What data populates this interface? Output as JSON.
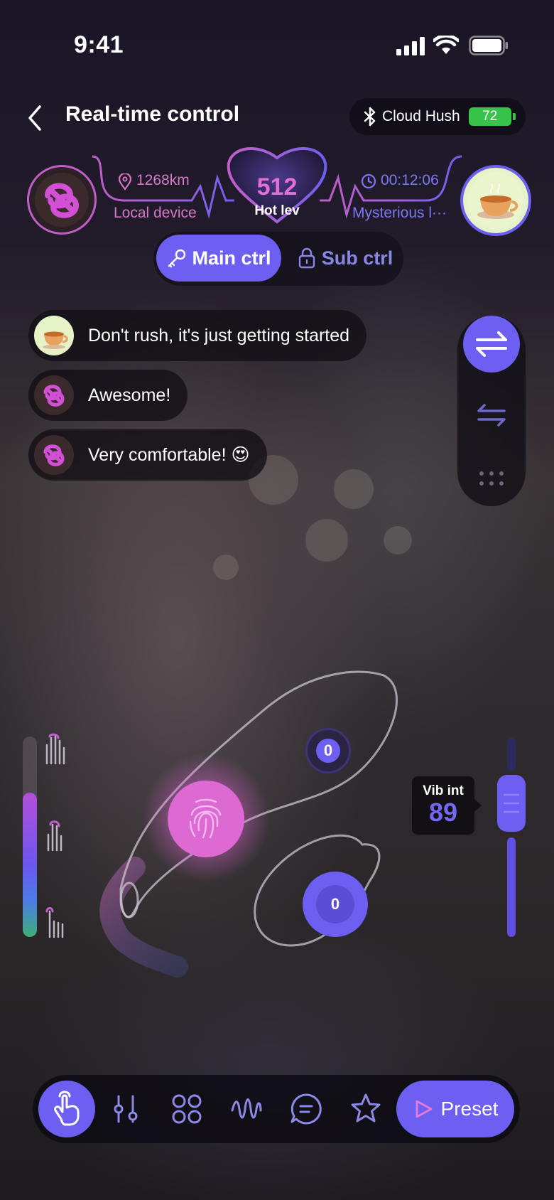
{
  "status_bar": {
    "time": "9:41"
  },
  "header": {
    "title": "Real-time control",
    "device_name": "Cloud Hush",
    "battery": "72"
  },
  "hot_level": {
    "value": "512",
    "label": "Hot lev",
    "distance": "1268km",
    "local_label": "Local device",
    "timer": "00:12:06",
    "remote_label": "Mysterious l···"
  },
  "tabs": [
    {
      "label": "Main ctrl",
      "active": true
    },
    {
      "label": "Sub ctrl",
      "active": false
    }
  ],
  "chat": [
    {
      "avatar": "teacup-avatar",
      "text": "Don't rush, it's just getting started"
    },
    {
      "avatar": "knot-avatar",
      "text": "Awesome!"
    },
    {
      "avatar": "knot-avatar",
      "text": "Very comfortable! 😍"
    }
  ],
  "mode_panel": {
    "icons": [
      "swap-arrows-icon",
      "swap-arrows-thin-icon",
      "grip-dots-icon"
    ]
  },
  "intensity_bar": {
    "level": 0.72
  },
  "vib_slider": {
    "title": "Vib int",
    "value": "89",
    "level": 0.89
  },
  "zones": {
    "top_badge": "0",
    "bottom_badge": "0"
  },
  "bottom_nav": {
    "icons": [
      "touch-hand-icon",
      "sliders-icon",
      "grid-icon",
      "wave-icon",
      "chat-icon",
      "star-icon"
    ],
    "preset_label": "Preset"
  },
  "colors": {
    "accent": "#6d5ff1",
    "pink": "#d679c9",
    "battery": "#38c44a"
  }
}
